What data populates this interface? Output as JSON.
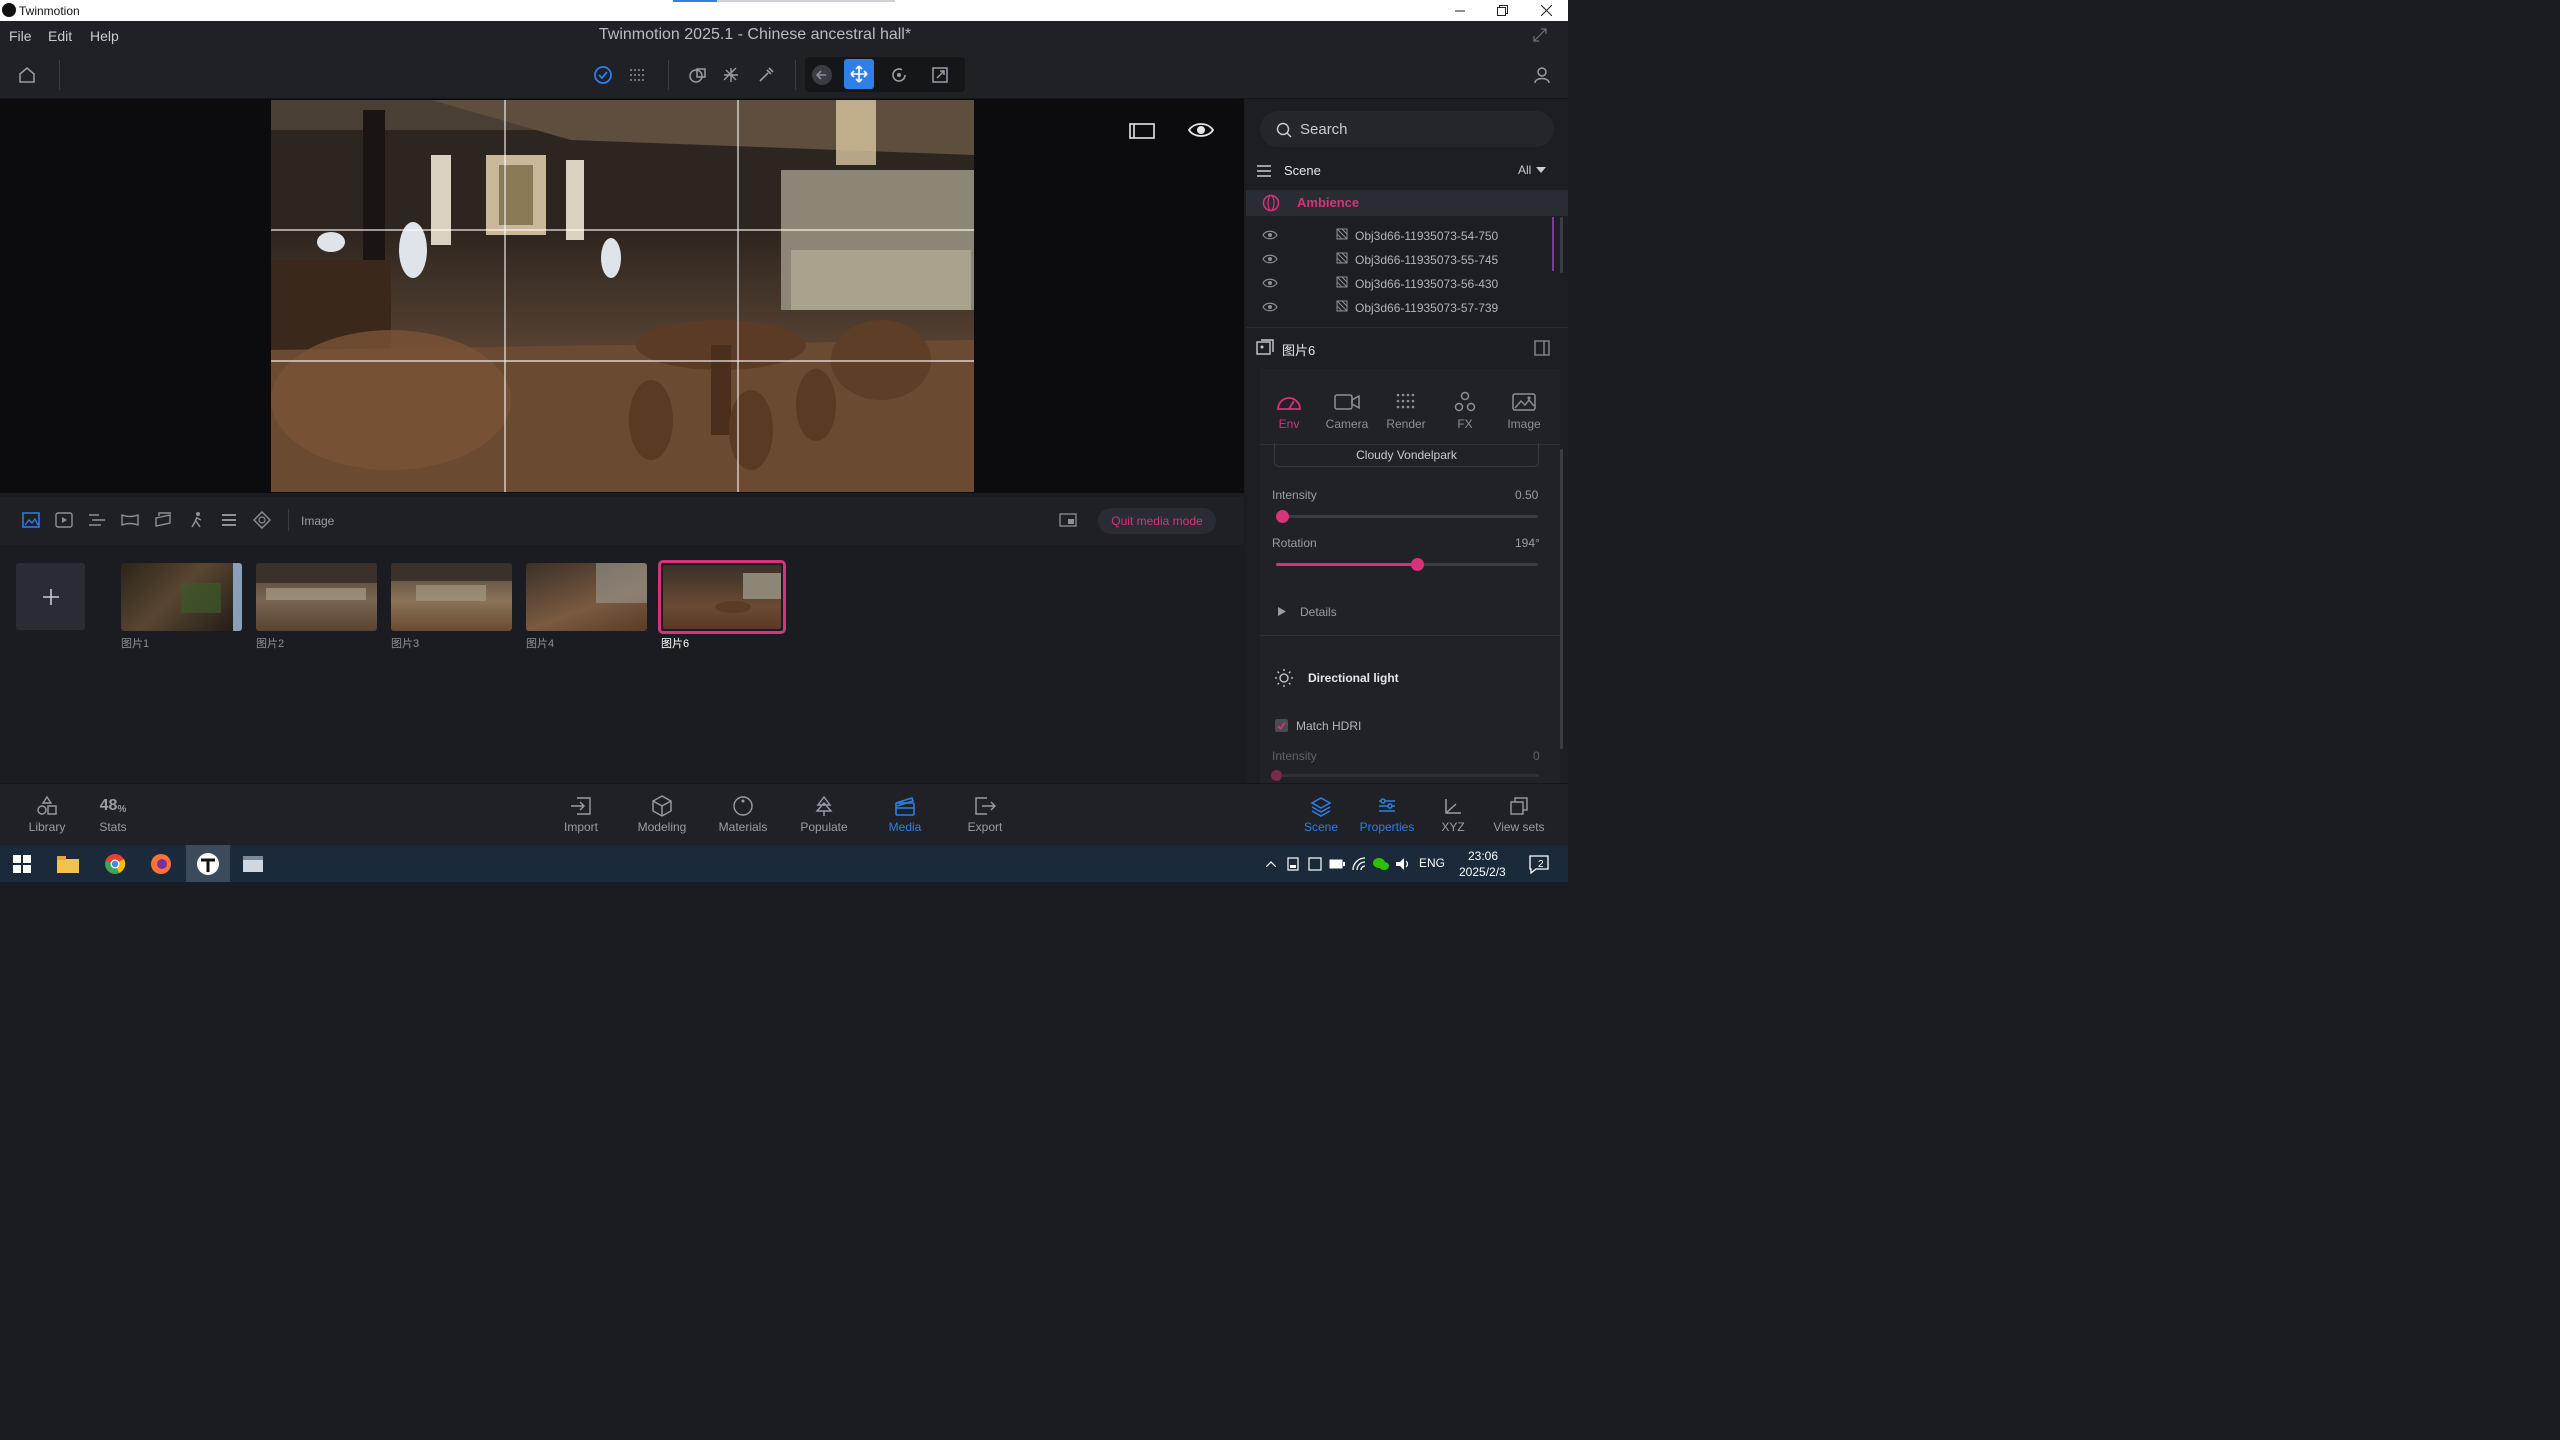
{
  "window": {
    "app_name": "Twinmotion"
  },
  "menu": {
    "file": "File",
    "edit": "Edit",
    "help": "Help"
  },
  "document_title": "Twinmotion 2025.1 - Chinese ancestral hall*",
  "media_bar": {
    "mode_label": "Image",
    "quit_label": "Quit media mode"
  },
  "thumbnails": [
    {
      "label": "图片1",
      "selected": false
    },
    {
      "label": "图片2",
      "selected": false
    },
    {
      "label": "图片3",
      "selected": false
    },
    {
      "label": "图片4",
      "selected": false
    },
    {
      "label": "图片6",
      "selected": true
    }
  ],
  "bottom_left": {
    "library": "Library",
    "stats_value": "48",
    "stats_unit": "%",
    "stats": "Stats"
  },
  "bottom_center": {
    "import": "Import",
    "modeling": "Modeling",
    "materials": "Materials",
    "populate": "Populate",
    "media": "Media",
    "export": "Export"
  },
  "bottom_right": {
    "scene": "Scene",
    "properties": "Properties",
    "xyz": "XYZ",
    "view_sets": "View sets"
  },
  "right_panel": {
    "search_placeholder": "Search",
    "scene_label": "Scene",
    "filter_value": "All",
    "ambience": "Ambience",
    "objects": [
      "Obj3d66-11935073-54-750",
      "Obj3d66-11935073-55-745",
      "Obj3d66-11935073-56-430",
      "Obj3d66-11935073-57-739"
    ],
    "selected_media": "图片6",
    "tabs": {
      "env": "Env",
      "camera": "Camera",
      "render": "Render",
      "fx": "FX",
      "image": "Image"
    },
    "hdri_name": "Cloudy Vondelpark",
    "intensity_label": "Intensity",
    "intensity_value": "0.50",
    "intensity_fraction": 0.0,
    "rotation_label": "Rotation",
    "rotation_value": "194°",
    "rotation_fraction": 0.54,
    "details_label": "Details",
    "directional_light_label": "Directional light",
    "match_hdri_label": "Match HDRI",
    "dl_intensity_label": "Intensity",
    "dl_intensity_value": "0"
  },
  "taskbar": {
    "language": "ENG",
    "time": "23:06",
    "date": "2025/2/3",
    "notif_count": "2"
  },
  "colors": {
    "accent_pink": "#d7327a",
    "accent_blue": "#2f7fe6",
    "panel_bg": "#1d1e23"
  }
}
